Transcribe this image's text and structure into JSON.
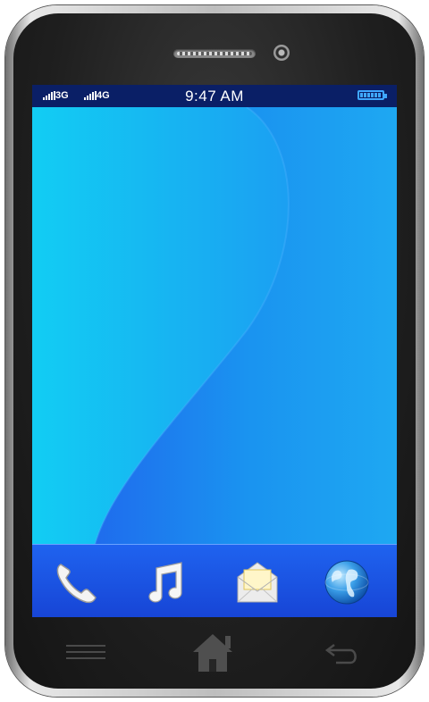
{
  "status_bar": {
    "network_1": "3G",
    "network_2": "4G",
    "time": "9:47 AM",
    "battery_level": 1.0
  },
  "dock": {
    "apps": [
      {
        "icon": "phone-icon"
      },
      {
        "icon": "music-note-icon"
      },
      {
        "icon": "mail-envelope-icon"
      },
      {
        "icon": "globe-icon"
      }
    ]
  },
  "hardware_buttons": [
    {
      "icon": "menu-lines-icon"
    },
    {
      "icon": "home-icon"
    },
    {
      "icon": "back-arrow-icon"
    }
  ],
  "colors": {
    "status_bar_bg": "#0a1f66",
    "wallpaper_light": "#12c8f2",
    "wallpaper_dark": "#1e74ee",
    "dock_bg": "#1f5ae8",
    "bezel": "#1f1f1f"
  }
}
